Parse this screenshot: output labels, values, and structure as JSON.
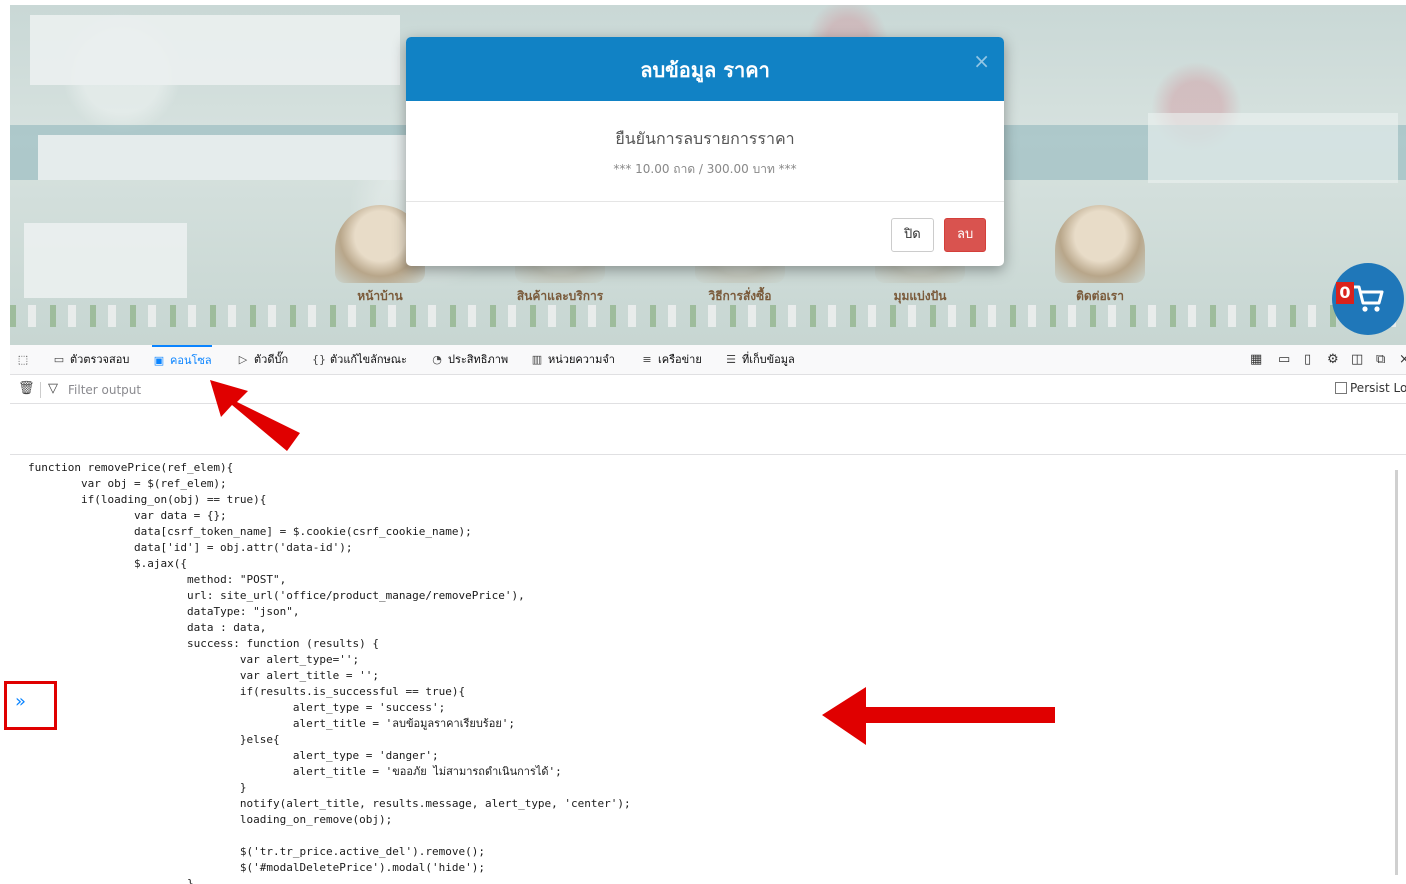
{
  "website": {
    "nav": [
      {
        "label": "หน้าบ้าน"
      },
      {
        "label": "สินค้าและบริการ"
      },
      {
        "label": "วิธีการสั่งซื้อ"
      },
      {
        "label": "มุมแบ่งปัน"
      },
      {
        "label": "ติดต่อเรา"
      }
    ],
    "cart_count": "0",
    "cart_icon": "shopping-cart-icon"
  },
  "modal": {
    "title": "ลบข้อมูล ราคา",
    "close_glyph": "×",
    "question": "ยืนยันการลบรายการราคา",
    "detail": "*** 10.00 ถาด / 300.00 บาท ***",
    "btn_close": "ปิด",
    "btn_delete": "ลบ",
    "colors": {
      "header": "#1182c5",
      "danger": "#d9534f"
    }
  },
  "devtools": {
    "tabs": [
      {
        "label": "ตัวตรวจสอบ",
        "icon": "inspector-icon"
      },
      {
        "label": "คอนโซล",
        "icon": "console-icon",
        "active": true
      },
      {
        "label": "ตัวดีบั๊ก",
        "icon": "debugger-icon"
      },
      {
        "label": "ตัวแก้ไขลักษณะ",
        "icon": "style-editor-icon"
      },
      {
        "label": "ประสิทธิภาพ",
        "icon": "performance-icon"
      },
      {
        "label": "หน่วยความจำ",
        "icon": "memory-icon"
      },
      {
        "label": "เครือข่าย",
        "icon": "network-icon"
      },
      {
        "label": "ที่เก็บข้อมูล",
        "icon": "storage-icon"
      }
    ],
    "filter_placeholder": "Filter output",
    "persist_logs": "Persist Logs",
    "accent": "#0a84ff",
    "prompt_glyph": "»"
  },
  "code_lines": [
    "function removePrice(ref_elem){",
    "\tvar obj = $(ref_elem);",
    "\tif(loading_on(obj) == true){",
    "\t\tvar data = {};",
    "\t\tdata[csrf_token_name] = $.cookie(csrf_cookie_name);",
    "\t\tdata['id'] = obj.attr('data-id');",
    "\t\t$.ajax({",
    "\t\t\tmethod: \"POST\",",
    "\t\t\turl: site_url('office/product_manage/removePrice'),",
    "\t\t\tdataType: \"json\",",
    "\t\t\tdata : data,",
    "\t\t\tsuccess: function (results) {",
    "\t\t\t\tvar alert_type='';",
    "\t\t\t\tvar alert_title = '';",
    "\t\t\t\tif(results.is_successful == true){",
    "\t\t\t\t\talert_type = 'success';",
    "\t\t\t\t\talert_title = 'ลบข้อมูลราคาเรียบร้อย';",
    "\t\t\t\t}else{",
    "\t\t\t\t\talert_type = 'danger';",
    "\t\t\t\t\talert_title = 'ขออภัย ไม่สามารถดำเนินการได้';",
    "\t\t\t\t}",
    "\t\t\t\tnotify(alert_title, results.message, alert_type, 'center');",
    "\t\t\t\tloading_on_remove(obj);",
    "",
    "\t\t\t\t$('tr.tr_price.active_del').remove();",
    "\t\t\t\t$('#modalDeletePrice').modal('hide');",
    "\t\t\t}"
  ],
  "annotations": {
    "color": "#e00000"
  }
}
